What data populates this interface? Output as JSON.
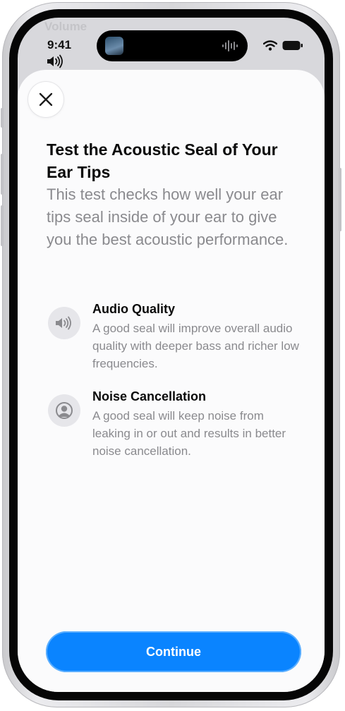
{
  "status_bar": {
    "time": "9:41",
    "background_hint": "Volume"
  },
  "sheet": {
    "close_icon": "xmark-icon",
    "title": "Test the Acoustic Seal of Your Ear Tips",
    "subtitle": "This test checks how well your ear tips seal inside of your ear to give you the best acoustic performance.",
    "features": [
      {
        "icon": "speaker-wave-icon",
        "title": "Audio Quality",
        "description": "A good seal will improve overall audio quality with deeper bass and richer low frequencies."
      },
      {
        "icon": "person-silhouette-icon",
        "title": "Noise Cancellation",
        "description": "A good seal will keep noise from leaking in or out and results in better noise cancellation."
      }
    ],
    "continue_label": "Continue"
  },
  "colors": {
    "accent": "#0A84FF",
    "secondary_text": "#8A8A8E",
    "sheet_background": "#FBFBFC"
  }
}
